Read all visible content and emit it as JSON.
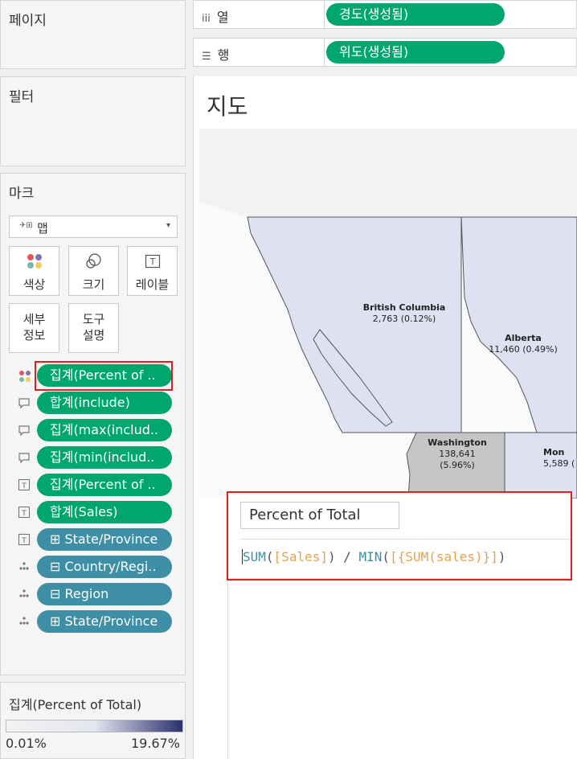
{
  "left": {
    "pages_title": "페이지",
    "filters_title": "필터",
    "marks": {
      "title": "마크",
      "mark_type": "맵",
      "buttons": [
        {
          "label": "색상",
          "icon": "color-dots-icon"
        },
        {
          "label": "크기",
          "icon": "size-icon"
        },
        {
          "label": "레이블",
          "icon": "label-icon"
        },
        {
          "label": "세부\n정보",
          "icon": ""
        },
        {
          "label": "도구\n설명",
          "icon": ""
        }
      ],
      "fields": [
        {
          "icon": "color-icon",
          "label": "집계(Percent of ..",
          "color": "green"
        },
        {
          "icon": "tooltip-icon",
          "label": "합계(include)",
          "color": "green"
        },
        {
          "icon": "tooltip-icon",
          "label": "집계(max(includ..",
          "color": "green"
        },
        {
          "icon": "tooltip-icon",
          "label": "집계(min(includ..",
          "color": "green"
        },
        {
          "icon": "label-icon",
          "label": "집계(Percent of ..",
          "color": "green"
        },
        {
          "icon": "label-icon",
          "label": "합계(Sales)",
          "color": "green"
        },
        {
          "icon": "label-icon",
          "label": "⊞ State/Province",
          "color": "blue"
        },
        {
          "icon": "detail-icon",
          "label": "⊟ Country/Regi..",
          "color": "blue"
        },
        {
          "icon": "detail-icon",
          "label": "⊟ Region",
          "color": "blue"
        },
        {
          "icon": "detail-icon",
          "label": "⊞ State/Province",
          "color": "blue"
        }
      ]
    },
    "legend": {
      "title": "집계(Percent of Total)",
      "min": "0.01%",
      "max": "19.67%",
      "color_low": "#f2f2f2",
      "color_high": "#2a2f6e"
    }
  },
  "shelves": {
    "columns": {
      "label": "열",
      "icon": "columns-icon",
      "pill": "경도(생성됨)"
    },
    "rows": {
      "label": "행",
      "icon": "rows-icon",
      "pill": "위도(생성됨)"
    }
  },
  "view": {
    "title": "지도",
    "map_labels": [
      {
        "name": "British Columbia",
        "value": "2,763 (0.12%)"
      },
      {
        "name": "Alberta",
        "value": "11,460 (0.49%)"
      },
      {
        "name": "Washington",
        "value": "138,641 (5.96%)"
      },
      {
        "name": "Mon",
        "value": "5,589 ("
      }
    ]
  },
  "calc_editor": {
    "name": "Percent of Total",
    "formula_parts": [
      {
        "text": "SUM",
        "role": "func"
      },
      {
        "text": "(",
        "role": "punct"
      },
      {
        "text": "[Sales]",
        "role": "field"
      },
      {
        "text": ") / ",
        "role": "punct"
      },
      {
        "text": "MIN",
        "role": "func"
      },
      {
        "text": "(",
        "role": "punct"
      },
      {
        "text": "[{SUM(sales)}]",
        "role": "field"
      },
      {
        "text": ")",
        "role": "punct"
      }
    ]
  },
  "colors": {
    "green_pill": "#00a66c",
    "blue_pill": "#3e8fa5",
    "highlight": "#e02020",
    "map_fill": "#dde1f2",
    "map_stroke": "#555555"
  }
}
